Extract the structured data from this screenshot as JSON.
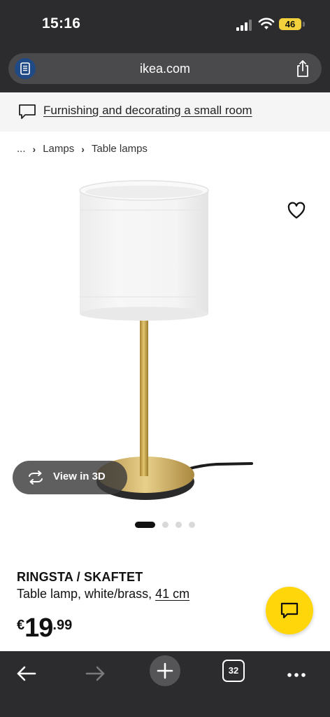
{
  "status_bar": {
    "time": "15:16",
    "battery": "46"
  },
  "browser": {
    "url": "ikea.com"
  },
  "banner": {
    "link_text": "Furnishing and decorating a small room"
  },
  "breadcrumb": {
    "ellipsis": "...",
    "items": [
      "Lamps",
      "Table lamps"
    ]
  },
  "gallery": {
    "view_3d_label": "View in 3D",
    "slide_count": 4,
    "active_slide": 1
  },
  "product": {
    "name": "RINGSTA / SKAFTET",
    "description": "Table lamp, white/brass,",
    "size": "41 cm",
    "price_currency": "€",
    "price_integer": "19",
    "price_decimal": ".99"
  },
  "toolbar": {
    "tab_count": "32"
  },
  "colors": {
    "chrome": "#2c2c2e",
    "ikea_yellow": "#ffd60a",
    "reader_blue": "#1f4a86"
  },
  "icons": [
    "signal-icon",
    "wifi-icon",
    "reader-icon",
    "share-icon",
    "chat-outline-icon",
    "heart-icon",
    "rotate-3d-icon",
    "chat-icon",
    "back-arrow-icon",
    "forward-arrow-icon",
    "plus-icon",
    "more-icon"
  ]
}
